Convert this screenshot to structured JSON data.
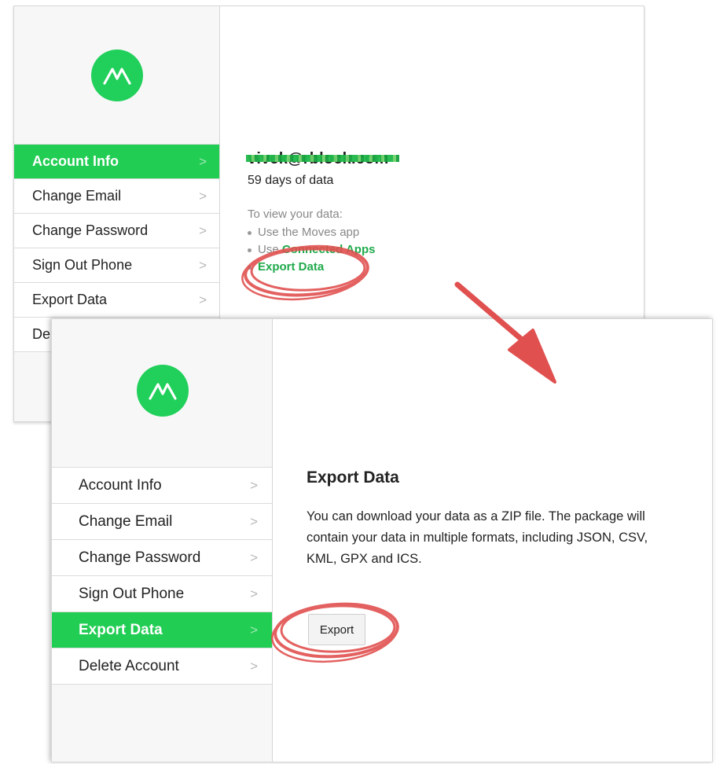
{
  "back_panel": {
    "menu": [
      {
        "label": "Account Info",
        "active": true
      },
      {
        "label": "Change Email",
        "active": false
      },
      {
        "label": "Change Password",
        "active": false
      },
      {
        "label": "Sign Out Phone",
        "active": false
      },
      {
        "label": "Export Data",
        "active": false
      },
      {
        "label": "Del",
        "active": false
      }
    ],
    "account": {
      "email": "vivek@rblock.com",
      "days": "59 days of data",
      "view_label": "To view your data:",
      "links": [
        {
          "prefix": "Use the Moves app",
          "link": ""
        },
        {
          "prefix": "Use ",
          "link": "Connected Apps"
        },
        {
          "prefix": "",
          "link": "Export Data"
        }
      ]
    }
  },
  "front_panel": {
    "menu": [
      {
        "label": "Account Info",
        "active": false
      },
      {
        "label": "Change Email",
        "active": false
      },
      {
        "label": "Change Password",
        "active": false
      },
      {
        "label": "Sign Out Phone",
        "active": false
      },
      {
        "label": "Export Data",
        "active": true
      },
      {
        "label": "Delete Account",
        "active": false
      }
    ],
    "title": "Export Data",
    "description": "You can download your data as a ZIP file. The package will contain your data in multiple formats, including JSON, CSV, KML, GPX and ICS.",
    "export_button": "Export"
  },
  "chevron": ">",
  "colors": {
    "brand_green": "#21cd53",
    "link_green": "#1faa4b",
    "annotation_red": "#e0504f"
  },
  "icons": {
    "logo": "moves-logo-icon"
  }
}
